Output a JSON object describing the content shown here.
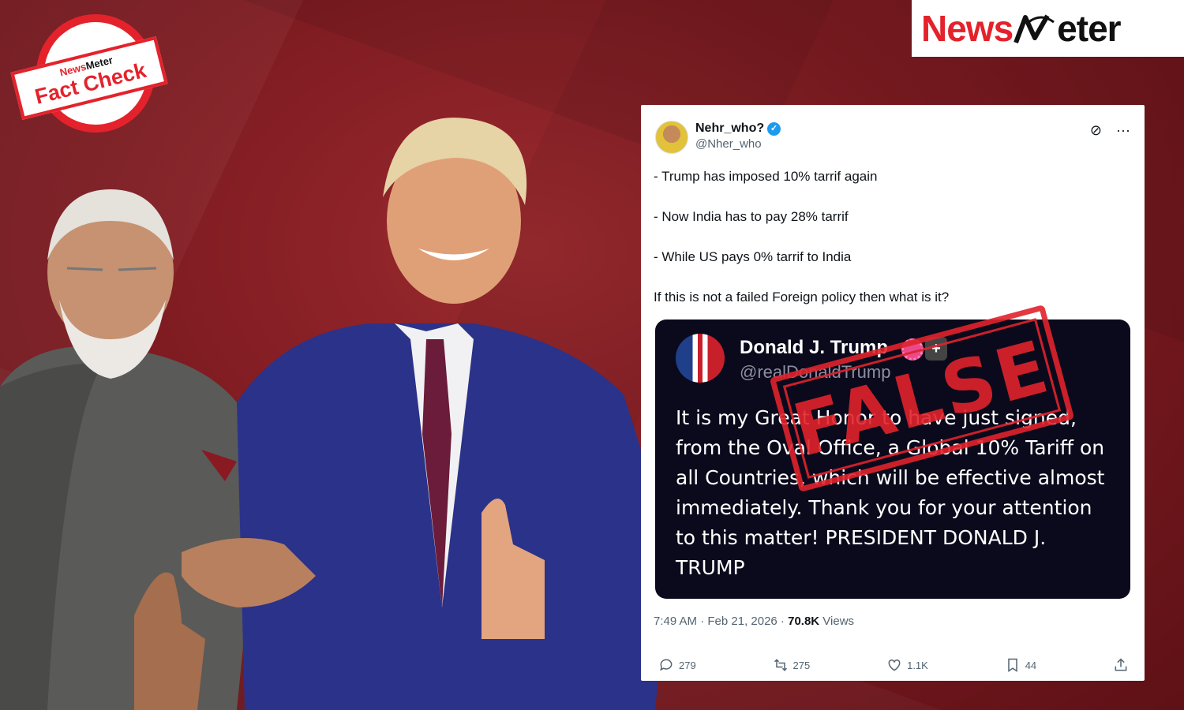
{
  "badge": {
    "brand_news": "News",
    "brand_meter": "Meter",
    "label": "Fact Check"
  },
  "logo": {
    "news": "News",
    "meter": "eter"
  },
  "tweet": {
    "display_name": "Nehr_who?",
    "handle": "@Nher_who",
    "lines": [
      "- Trump has imposed 10% tarrif again",
      "- Now India has to pay 28% tarrif",
      "- While US pays 0% tarrif to India",
      "If this is not a failed Foreign policy then what is it?"
    ],
    "embed": {
      "name": "Donald J. Trump",
      "handle": "@realDonaldTrump",
      "text": "It is my Great Honor to have just signed, from the Oval Office, a Global 10% Tariff on all Countries, which will be effective almost immediately. Thank you for your attention to this matter! PRESIDENT DONALD J. TRUMP"
    },
    "time": "7:49 AM · Feb 21, 2026 · ",
    "views_count": "70.8K",
    "views_label": " Views",
    "actions": {
      "replies": "279",
      "reposts": "275",
      "likes": "1.1K",
      "bookmarks": "44"
    }
  },
  "stamp": {
    "text": "FALSE"
  },
  "colors": {
    "brand_red": "#e4222b",
    "background": "#7d1b21",
    "embed_bg": "#0b0a1c"
  },
  "icons": [
    "verified-badge-icon",
    "grok-icon",
    "more-icon",
    "reply-icon",
    "repost-icon",
    "like-icon",
    "bookmark-icon",
    "share-icon"
  ]
}
